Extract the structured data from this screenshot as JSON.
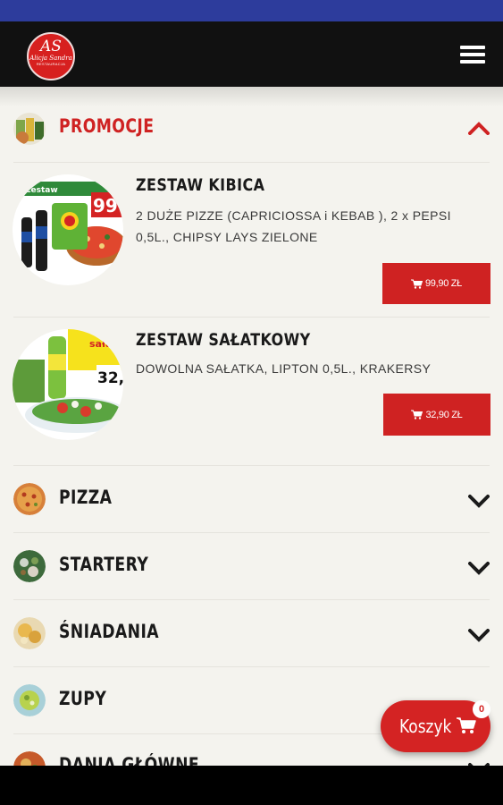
{
  "header": {
    "logo_line1": "AS",
    "logo_line2": "Alicja Sandra",
    "logo_line3": "RESTAURACJA"
  },
  "categories": [
    {
      "name": "PROMOCJE",
      "expanded": true,
      "icon": "chevron-up-icon",
      "color": "#cf2222"
    },
    {
      "name": "PIZZA",
      "expanded": false,
      "icon": "chevron-down-icon"
    },
    {
      "name": "STARTERY",
      "expanded": false,
      "icon": "chevron-down-icon"
    },
    {
      "name": "ŚNIADANIA",
      "expanded": false,
      "icon": "chevron-down-icon"
    },
    {
      "name": "ZUPY",
      "expanded": false,
      "icon": "chevron-down-icon"
    },
    {
      "name": "DANIA GŁÓWNE",
      "expanded": false,
      "icon": "chevron-down-icon"
    }
  ],
  "products": [
    {
      "name": "ZESTAW KIBICA",
      "description": "2 DUŻE PIZZE (CAPRICIOSSA i KEBAB ), 2 x PEPSI 0,5L., CHIPSY LAYS ZIELONE",
      "price": "99,90 ZŁ",
      "img_badge": "99",
      "img_banner": "Zestaw"
    },
    {
      "name": "ZESTAW SAŁATKOWY",
      "description": "DOWOLNA SAŁATKA, LIPTON 0,5L., KRAKERSY",
      "price": "32,90 ZŁ",
      "img_badge": "32,",
      "img_banner": "sałatkowy"
    }
  ],
  "cart": {
    "label": "Koszyk",
    "count": "0",
    "icon": "cart-icon"
  },
  "colors": {
    "accent": "#cf2222",
    "topbar": "#111111",
    "statusbar": "#2d3c9c",
    "background": "#f4f3ee"
  }
}
